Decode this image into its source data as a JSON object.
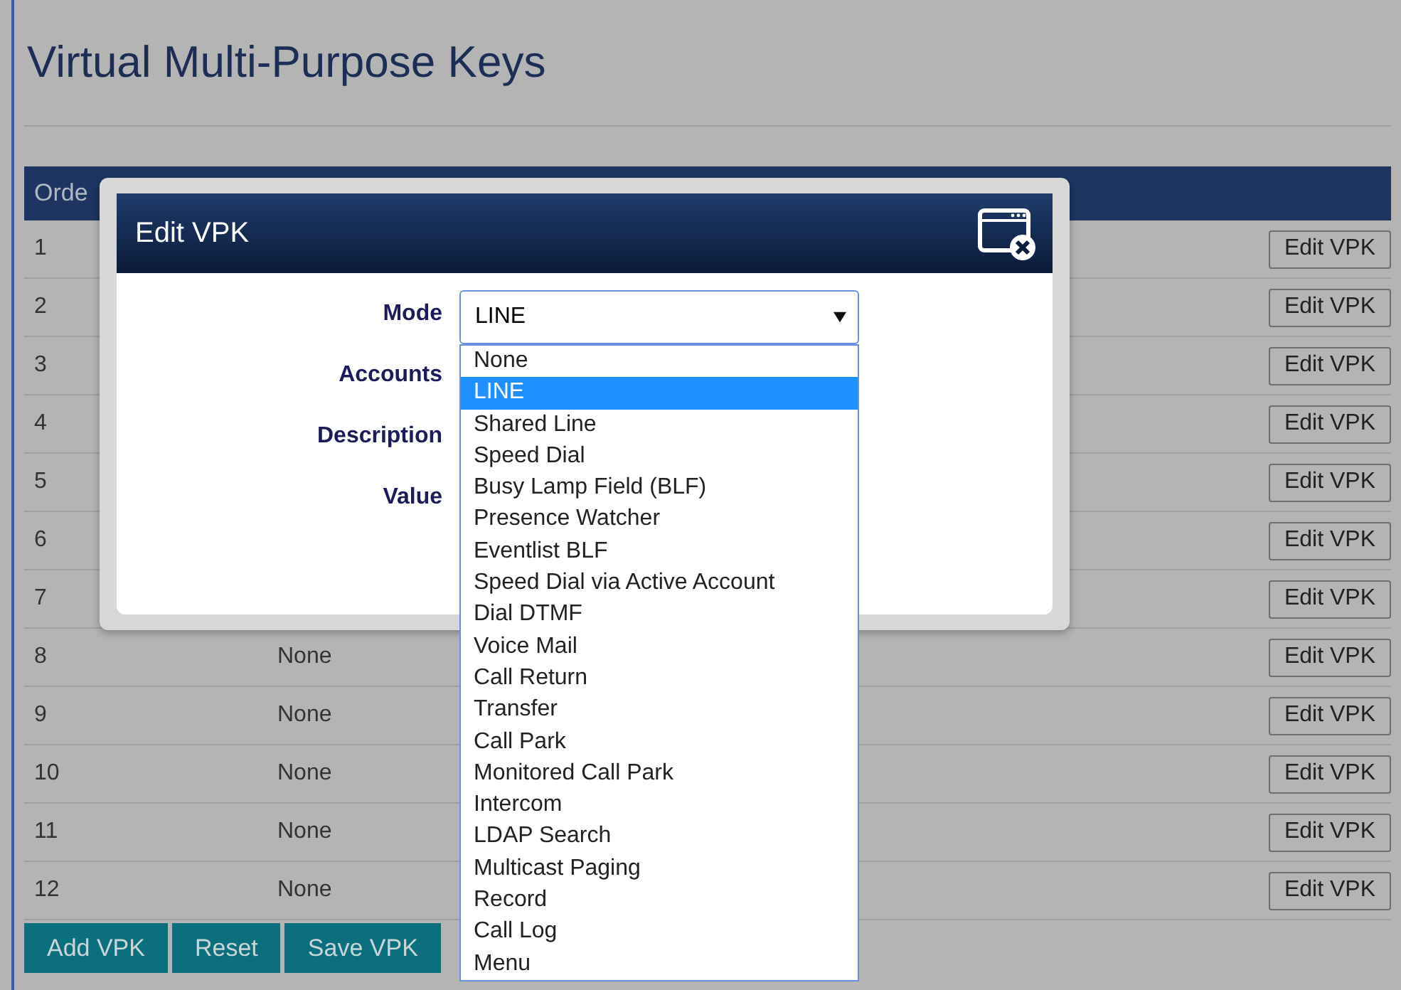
{
  "page": {
    "title": "Virtual Multi-Purpose Keys"
  },
  "table": {
    "columns": [
      "Orde"
    ],
    "rows": [
      {
        "order": "1",
        "action": "Edit VPK"
      },
      {
        "order": "2",
        "action": "Edit VPK"
      },
      {
        "order": "3",
        "action": "Edit VPK"
      },
      {
        "order": "4",
        "action": "Edit VPK"
      },
      {
        "order": "5",
        "action": "Edit VPK"
      },
      {
        "order": "6",
        "action": "Edit VPK"
      },
      {
        "order": "7",
        "action": "Edit VPK"
      },
      {
        "order": "8",
        "mode": "None",
        "action": "Edit VPK"
      },
      {
        "order": "9",
        "mode": "None",
        "action": "Edit VPK"
      },
      {
        "order": "10",
        "mode": "None",
        "action": "Edit VPK"
      },
      {
        "order": "11",
        "mode": "None",
        "action": "Edit VPK"
      },
      {
        "order": "12",
        "mode": "None",
        "action": "Edit VPK"
      }
    ]
  },
  "buttons": [
    "Add VPK",
    "Reset",
    "Save VPK"
  ],
  "dialog": {
    "title": "Edit VPK",
    "labels": [
      "Mode",
      "Accounts",
      "Description",
      "Value"
    ],
    "mode_value": "LINE",
    "options": [
      {
        "label": "None",
        "selected": false
      },
      {
        "label": "LINE",
        "selected": true
      },
      {
        "label": "Shared Line",
        "selected": false
      },
      {
        "label": "Speed Dial",
        "selected": false
      },
      {
        "label": "Busy Lamp Field (BLF)",
        "selected": false
      },
      {
        "label": "Presence Watcher",
        "selected": false
      },
      {
        "label": "Eventlist BLF",
        "selected": false
      },
      {
        "label": "Speed Dial via Active Account",
        "selected": false
      },
      {
        "label": "Dial DTMF",
        "selected": false
      },
      {
        "label": "Voice Mail",
        "selected": false
      },
      {
        "label": "Call Return",
        "selected": false
      },
      {
        "label": "Transfer",
        "selected": false
      },
      {
        "label": "Call Park",
        "selected": false
      },
      {
        "label": "Monitored Call Park",
        "selected": false
      },
      {
        "label": "Intercom",
        "selected": false
      },
      {
        "label": "LDAP Search",
        "selected": false
      },
      {
        "label": "Multicast Paging",
        "selected": false
      },
      {
        "label": "Record",
        "selected": false
      },
      {
        "label": "Call Log",
        "selected": false
      },
      {
        "label": "Menu",
        "selected": false
      }
    ]
  }
}
